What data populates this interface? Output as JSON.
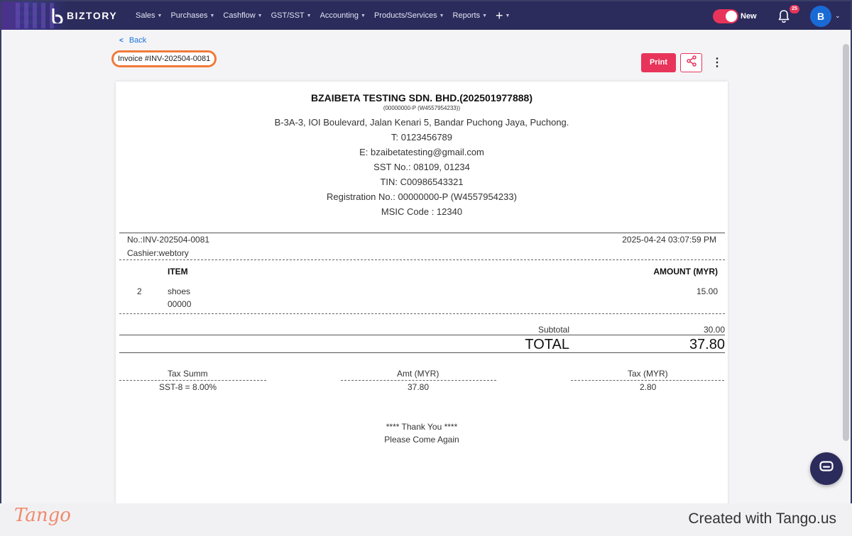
{
  "nav": {
    "brand": "BIZTORY",
    "menu": [
      {
        "label": "Sales"
      },
      {
        "label": "Purchases"
      },
      {
        "label": "Cashflow"
      },
      {
        "label": "GST/SST"
      },
      {
        "label": "Accounting"
      },
      {
        "label": "Products/Services"
      },
      {
        "label": "Reports"
      }
    ],
    "plus": "+",
    "new_label": "New",
    "notif_count": "25",
    "avatar_initial": "B",
    "colors": {
      "nav_bg": "#2b2b5c",
      "accent": "#e8345a",
      "avatar": "#1a6ad6"
    }
  },
  "header": {
    "back_label": "Back",
    "invoice_title": "Invoice #INV-202504-0081",
    "print_label": "Print",
    "icons": {
      "back": "chevron-left-icon",
      "share": "share-icon",
      "more": "more-vertical-icon"
    }
  },
  "receipt": {
    "company": "BZAIBETA TESTING SDN. BHD.(202501977888)",
    "reg_small": "(00000000-P (W4557954233))",
    "address_lines": [
      "B-3A-3, IOI Boulevard, Jalan Kenari 5, Bandar Puchong Jaya, Puchong.",
      "T: 0123456789",
      "E: bzaibetatesting@gmail.com",
      "SST No.: 08109, 01234",
      "TIN: C00986543321",
      "Registration No.: 00000000-P (W4557954233)",
      "MSIC Code : 12340"
    ],
    "doc_no": "No.:INV-202504-0081",
    "datetime": "2025-04-24 03:07:59 PM",
    "cashier": "Cashier:webtory",
    "col_item": "ITEM",
    "col_amount": "AMOUNT (MYR)",
    "items": [
      {
        "qty": "2",
        "name": "shoes",
        "code": "00000",
        "amount": "15.00"
      }
    ],
    "subtotal_label": "Subtotal",
    "subtotal": "30.00",
    "total_label": "TOTAL",
    "total": "37.80",
    "tax": {
      "h1": "Tax Summ",
      "h2": "Amt (MYR)",
      "h3": "Tax (MYR)",
      "rows": [
        {
          "name": "SST-8 = 8.00%",
          "amt": "37.80",
          "tax": "2.80"
        }
      ]
    },
    "thanks": "**** Thank You ****",
    "come_again": "Please Come Again"
  },
  "footer": {
    "tango": "Tango",
    "created": "Created with Tango.us"
  }
}
